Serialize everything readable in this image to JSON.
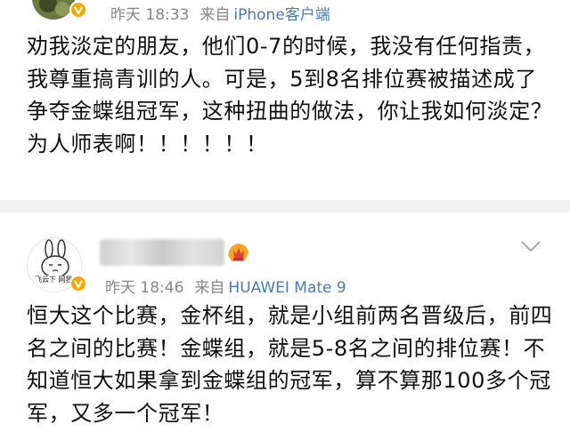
{
  "posts": [
    {
      "meta": {
        "time": "昨天 18:33",
        "from_label": "来自",
        "client": "iPhone客户端"
      },
      "text": "劝我淡定的朋友，他们0-7的时候，我没有任何指责，我尊重搞青训的人。可是，5到8名排位赛被描述成了争夺金蝶组冠军，这种扭曲的做法，你让我如何淡定？为人师表啊！！！！！！"
    },
    {
      "avatar_text": "飞云下  网我",
      "meta": {
        "time": "昨天 18:46",
        "from_label": "来自",
        "client": "HUAWEI Mate 9"
      },
      "text": "恒大这个比赛，金杯组，就是小组前两名晋级后，前四名之间的比赛！金蝶组，就是5-8名之间的排位赛！不知道恒大如果拿到金蝶组的冠军，算不算那100多个冠军，又多一个冠军！"
    }
  ],
  "colors": {
    "link": "#4a7bb7",
    "meta": "#888888",
    "badge": "#f2a900",
    "separator": "#f2f2f2"
  },
  "icons": [
    "verified-badge-icon",
    "rank-badge-icon",
    "chevron-down-icon"
  ]
}
